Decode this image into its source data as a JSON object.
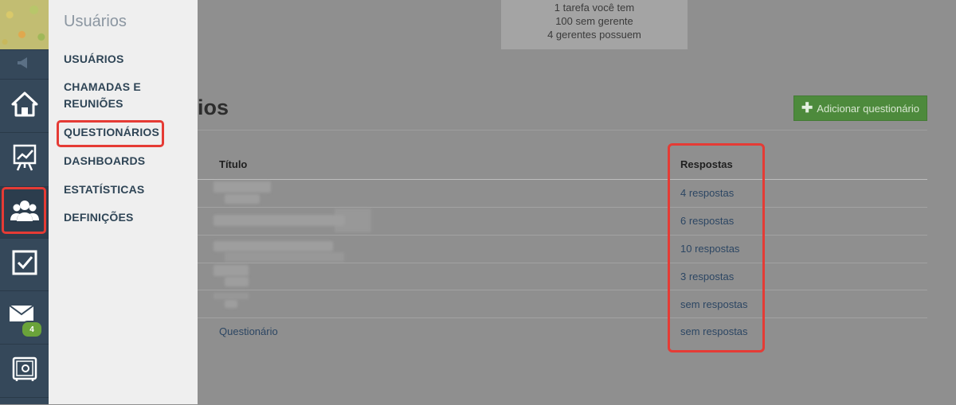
{
  "flyout": {
    "title": "Usuários",
    "items": [
      {
        "label": "USUÁRIOS"
      },
      {
        "label": "CHAMADAS E"
      },
      {
        "label": "REUNIÕES"
      },
      {
        "label": "QUESTIONÁRIOS"
      },
      {
        "label": "DASHBOARDS"
      },
      {
        "label": "ESTATÍSTICAS"
      },
      {
        "label": "DEFINIÇÕES"
      }
    ]
  },
  "rail": {
    "icons": [
      "megaphone-icon",
      "home-icon",
      "chart-easel-icon",
      "users-icon",
      "checkbox-icon",
      "mail-icon",
      "safe-icon"
    ],
    "mail_badge": "4"
  },
  "notice": {
    "lines": [
      "1 tarefa você tem",
      "100 sem gerente",
      "4 gerentes possuem"
    ]
  },
  "page": {
    "title_visible": "ios",
    "add_button": "Adicionar questionário"
  },
  "table": {
    "headers": {
      "title": "Título",
      "responses": "Respostas"
    },
    "rows": [
      {
        "title": "",
        "responses": "4 respostas"
      },
      {
        "title": "",
        "responses": "6 respostas"
      },
      {
        "title": "",
        "responses": "10 respostas"
      },
      {
        "title": "",
        "responses": "3 respostas"
      },
      {
        "title": "",
        "responses": "sem respostas"
      },
      {
        "title": "Questionário",
        "responses": "sem respostas"
      }
    ]
  },
  "colors": {
    "rail_bg": "#35485a",
    "highlight": "#e53b35",
    "add_button": "#4d8a3c",
    "link": "#2c4663"
  }
}
